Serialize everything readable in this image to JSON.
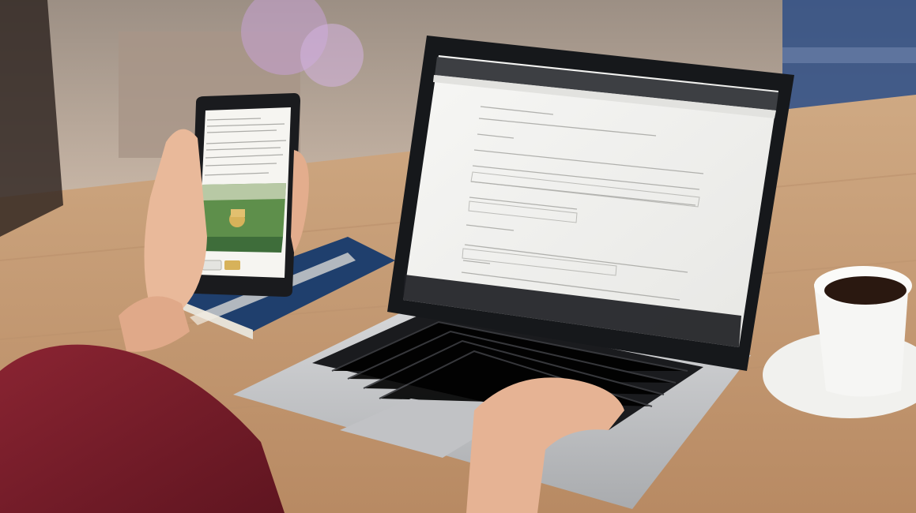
{
  "scene": {
    "description_tags": [
      "person",
      "laptop",
      "smartphone",
      "coffee-cup",
      "notebook",
      "wooden-table"
    ]
  },
  "colors": {
    "background_wall": "#b9aa9c",
    "table_wood": "#c49a74",
    "shirt_red": "#7a1f2b",
    "skin": "#e9b99a",
    "laptop_silver": "#c8c9cb",
    "laptop_bezel": "#16181b",
    "screen_page": "#f3f3f1",
    "notebook_blue": "#1f3f6d",
    "cup_white": "#f6f6f4",
    "coffee": "#2a1810",
    "phone_screen_accent": "#d7b25a"
  }
}
